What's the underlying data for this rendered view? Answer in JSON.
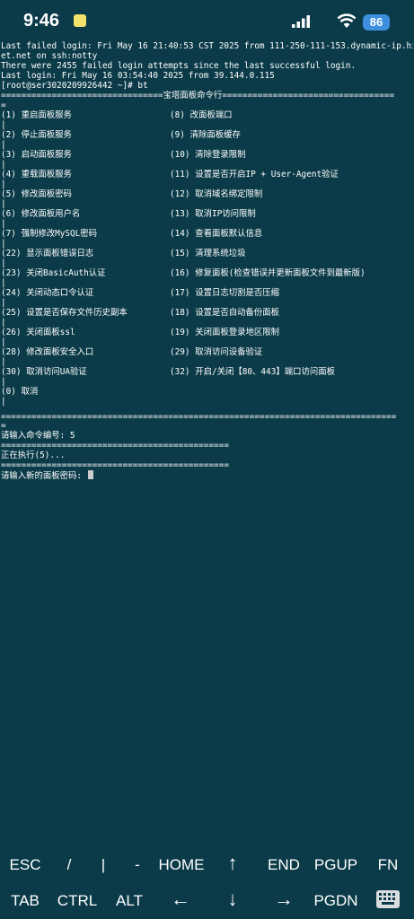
{
  "status_bar": {
    "time": "9:46",
    "battery": "86"
  },
  "terminal": {
    "header_lines": [
      "Last failed login: Fri May 16 21:40:53 CST 2025 from 111-250-111-153.dynamic-ip.hin",
      "et.net on ssh:notty",
      "There were 2455 failed login attempts since the last successful login.",
      "Last login: Fri May 16 03:54:40 2025 from 39.144.0.115",
      "[root@ser3020209926442 ~]# bt"
    ],
    "title_bar": "================================宝塔面板命令行==================================",
    "title_bar_cont": "=",
    "menu_rows": [
      {
        "left": "(1) 重启面板服务",
        "right": "(8) 改面板端口"
      },
      {
        "left": "(2) 停止面板服务",
        "right": "(9) 清除面板缓存"
      },
      {
        "left": "(3) 启动面板服务",
        "right": "(10) 清除登录限制"
      },
      {
        "left": "(4) 重载面板服务",
        "right": "(11) 设置是否开启IP + User-Agent验证"
      },
      {
        "left": "(5) 修改面板密码",
        "right": "(12) 取消域名绑定限制"
      },
      {
        "left": "(6) 修改面板用户名",
        "right": "(13) 取消IP访问限制"
      },
      {
        "left": "(7) 强制修改MySQL密码",
        "right": "(14) 查看面板默认信息"
      },
      {
        "left": "(22) 显示面板错误日志",
        "right": "(15) 清理系统垃圾"
      },
      {
        "left": "(23) 关闭BasicAuth认证",
        "right": "(16) 修复面板(检查错误并更新面板文件到最新版)"
      },
      {
        "left": "(24) 关闭动态口令认证",
        "right": "(17) 设置日志切割是否压缩"
      },
      {
        "left": "(25) 设置是否保存文件历史副本",
        "right": "(18) 设置是否自动备份面板"
      },
      {
        "left": "(26) 关闭面板ssl",
        "right": "(19) 关闭面板登录地区限制"
      },
      {
        "left": "(28) 修改面板安全入口",
        "right": "(29) 取消访问设备验证"
      },
      {
        "left": "(30) 取消访问UA验证",
        "right": "(32) 开启/关闭【80、443】端口访问面板"
      },
      {
        "left": "(0) 取消",
        "right": ""
      }
    ],
    "pipe": "|",
    "bottom_bar": "==============================================================================",
    "bottom_bar_cont": "=",
    "prompt_command": "请输入命令编号: 5",
    "short_bar_1": "=============================================",
    "executing": "正在执行(5)...",
    "short_bar_2": "=============================================",
    "prompt_password": "请输入新的面板密码: "
  },
  "extra_keys": {
    "row1": [
      "ESC",
      "/",
      "|",
      "-",
      "HOME",
      "↑",
      "END",
      "PGUP",
      "FN"
    ],
    "row2": [
      "TAB",
      "CTRL",
      "ALT",
      "←",
      "↓",
      "→",
      "PGDN"
    ],
    "keyboard_icon": "keyboard-icon"
  },
  "colors": {
    "background": "#0b3b48",
    "text": "#ffffff",
    "battery": "#3d8fe0"
  }
}
